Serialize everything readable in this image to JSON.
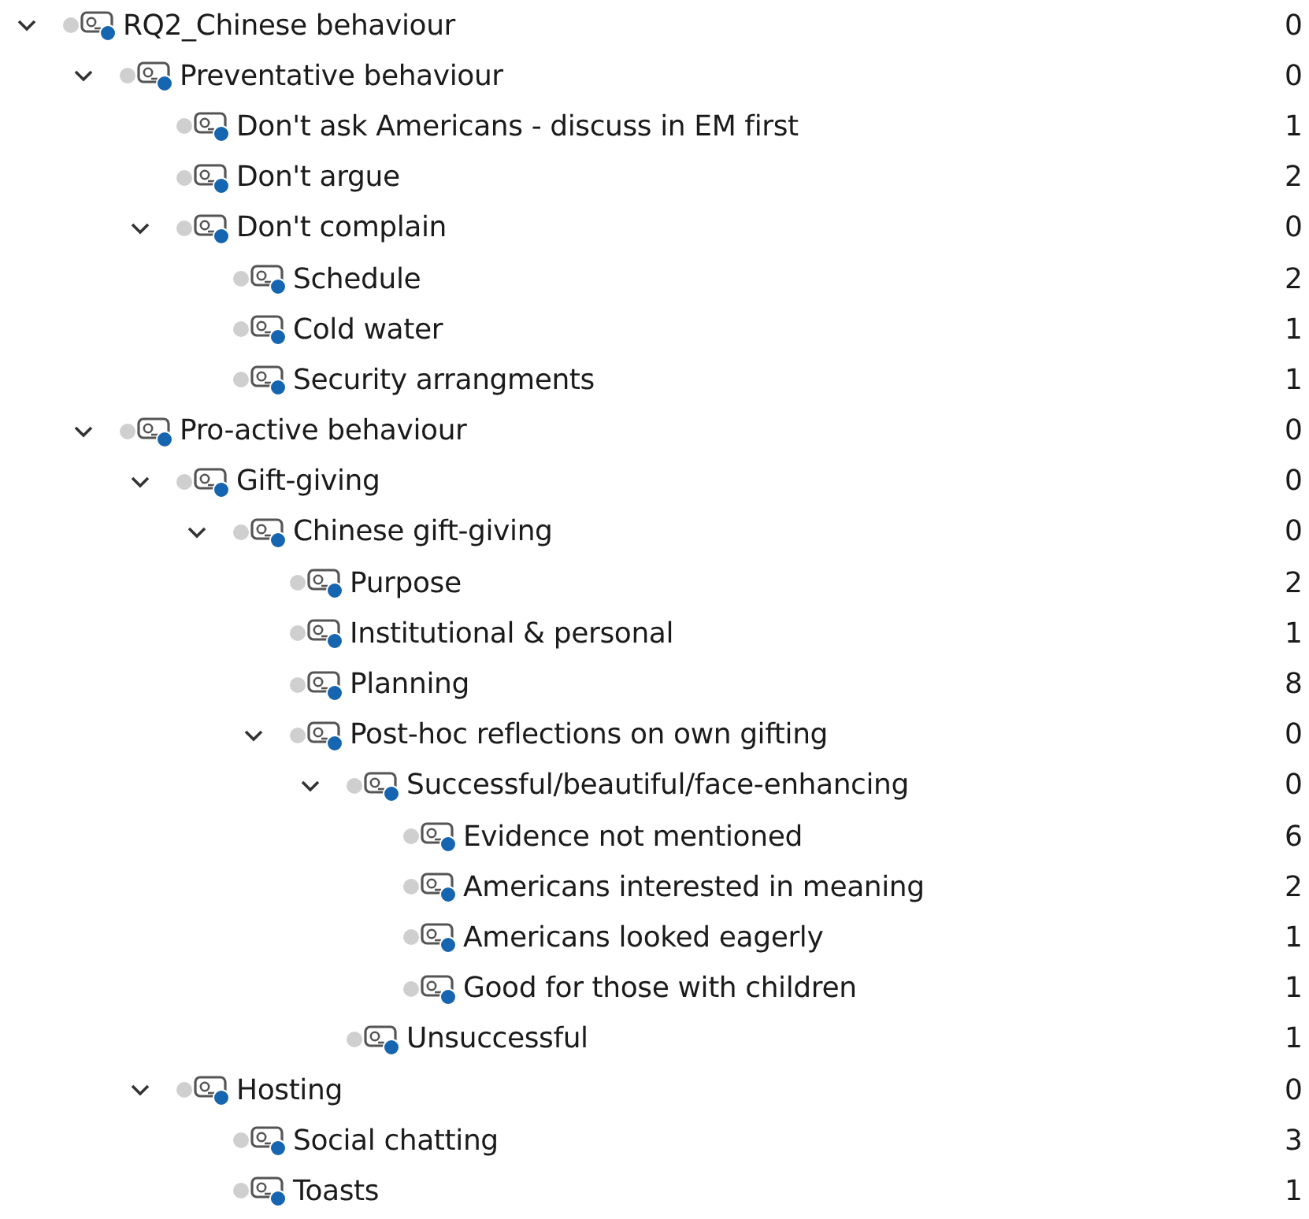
{
  "tree": [
    {
      "label": "RQ2_Chinese behaviour",
      "count": "0",
      "expanded": true,
      "children": [
        {
          "label": "Preventative behaviour",
          "count": "0",
          "expanded": true,
          "children": [
            {
              "label": "Don't ask Americans - discuss in EM first",
              "count": "1"
            },
            {
              "label": "Don't argue",
              "count": "2"
            },
            {
              "label": "Don't complain",
              "count": "0",
              "expanded": true,
              "children": [
                {
                  "label": "Schedule",
                  "count": "2"
                },
                {
                  "label": "Cold water",
                  "count": "1"
                },
                {
                  "label": "Security arrangments",
                  "count": "1"
                }
              ]
            }
          ]
        },
        {
          "label": "Pro-active behaviour",
          "count": "0",
          "expanded": true,
          "children": [
            {
              "label": "Gift-giving",
              "count": "0",
              "expanded": true,
              "children": [
                {
                  "label": "Chinese gift-giving",
                  "count": "0",
                  "expanded": true,
                  "children": [
                    {
                      "label": "Purpose",
                      "count": "2"
                    },
                    {
                      "label": "Institutional & personal",
                      "count": "1"
                    },
                    {
                      "label": "Planning",
                      "count": "8"
                    },
                    {
                      "label": "Post-hoc reflections on own gifting",
                      "count": "0",
                      "expanded": true,
                      "children": [
                        {
                          "label": "Successful/beautiful/face-enhancing",
                          "count": "0",
                          "expanded": true,
                          "children": [
                            {
                              "label": "Evidence not mentioned",
                              "count": "6"
                            },
                            {
                              "label": "Americans interested in meaning",
                              "count": "2"
                            },
                            {
                              "label": "Americans looked eagerly",
                              "count": "1"
                            },
                            {
                              "label": "Good for those with children",
                              "count": "1"
                            }
                          ]
                        },
                        {
                          "label": "Unsuccessful",
                          "count": "1"
                        }
                      ]
                    }
                  ]
                }
              ]
            },
            {
              "label": "Hosting",
              "count": "0",
              "expanded": true,
              "children": [
                {
                  "label": "Social chatting",
                  "count": "3"
                },
                {
                  "label": "Toasts",
                  "count": "1"
                }
              ]
            }
          ]
        }
      ]
    }
  ]
}
